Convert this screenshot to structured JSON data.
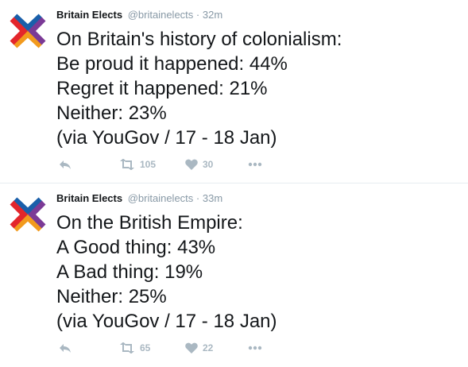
{
  "tweets": [
    {
      "name": "Britain Elects",
      "handle": "@britainelects",
      "separator": "·",
      "time": "32m",
      "lines": [
        "On Britain's history of colonialism:",
        "Be proud it happened: 44%",
        "Regret it happened: 21%",
        "Neither: 23%",
        "(via YouGov / 17 - 18 Jan)"
      ],
      "retweets": "105",
      "likes": "30"
    },
    {
      "name": "Britain Elects",
      "handle": "@britainelects",
      "separator": "·",
      "time": "33m",
      "lines": [
        "On the British Empire:",
        "A Good thing: 43%",
        "A Bad thing: 19%",
        "Neither: 25%",
        "(via YouGov / 17 - 18 Jan)"
      ],
      "retweets": "65",
      "likes": "22"
    }
  ],
  "icons": {
    "avatar": "britain-elects-logo",
    "reply": "reply-icon",
    "retweet": "retweet-icon",
    "like": "heart-icon",
    "more": "more-icon"
  },
  "colors": {
    "logo_blue": "#1a5faa",
    "logo_red": "#e3262b",
    "logo_orange": "#f29a1d",
    "logo_purple": "#7b3a96",
    "muted": "#8899a6",
    "icon": "#aab8c2"
  }
}
